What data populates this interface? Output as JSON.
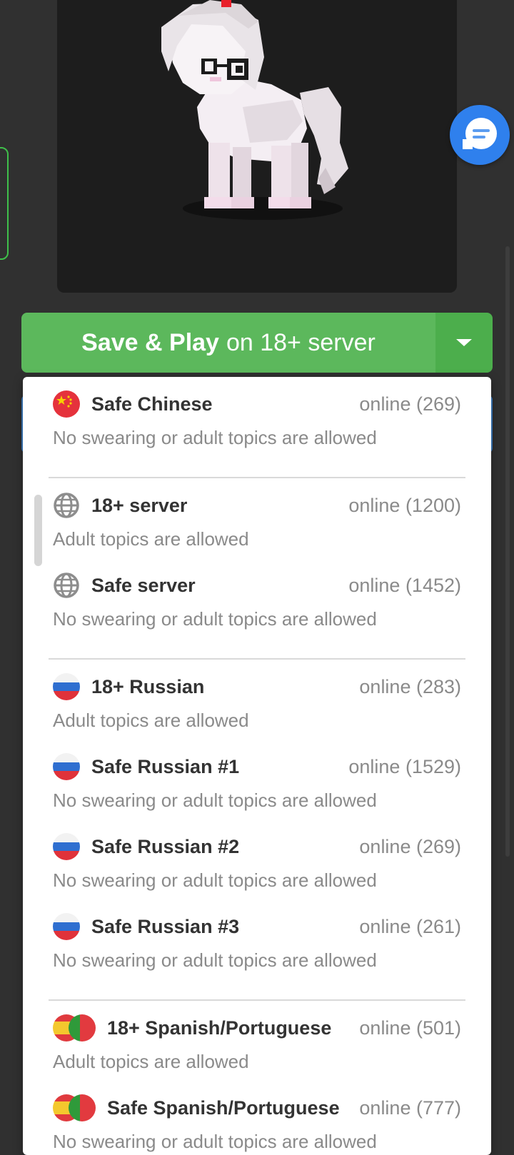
{
  "play": {
    "label_bold": "Save & Play",
    "label_rest": "on 18+ server"
  },
  "groups": [
    {
      "items": [
        {
          "name": "Safe Chinese",
          "online": "online (269)",
          "desc": "No swearing or adult topics are allowed",
          "flag": "china-flag-icon"
        }
      ]
    },
    {
      "items": [
        {
          "name": "18+ server",
          "online": "online (1200)",
          "desc": "Adult topics are allowed",
          "flag": "globe-icon"
        },
        {
          "name": "Safe server",
          "online": "online (1452)",
          "desc": "No swearing or adult topics are allowed",
          "flag": "globe-icon"
        }
      ]
    },
    {
      "items": [
        {
          "name": "18+ Russian",
          "online": "online (283)",
          "desc": "Adult topics are allowed",
          "flag": "russia-flag-icon"
        },
        {
          "name": "Safe Russian #1",
          "online": "online (1529)",
          "desc": "No swearing or adult topics are allowed",
          "flag": "russia-flag-icon"
        },
        {
          "name": "Safe Russian #2",
          "online": "online (269)",
          "desc": "No swearing or adult topics are allowed",
          "flag": "russia-flag-icon"
        },
        {
          "name": "Safe Russian #3",
          "online": "online (261)",
          "desc": "No swearing or adult topics are allowed",
          "flag": "russia-flag-icon"
        }
      ]
    },
    {
      "items": [
        {
          "name": "18+ Spanish/Portuguese",
          "online": "online (501)",
          "desc": "Adult topics are allowed",
          "flag": "spain-portugal-flag-icon"
        },
        {
          "name": "Safe Spanish/Portuguese",
          "online": "online (777)",
          "desc": "No swearing or adult topics are allowed",
          "flag": "spain-portugal-flag-icon"
        }
      ]
    }
  ],
  "icons": {
    "chat_fab": "chat-bubble-icon",
    "caret": "caret-down-icon"
  },
  "colors": {
    "play_green": "#5cb85c",
    "play_green_dark": "#4cae4c",
    "chat_blue": "#2f80ed",
    "text_dark": "#333333",
    "text_muted": "#8a8a8a"
  }
}
